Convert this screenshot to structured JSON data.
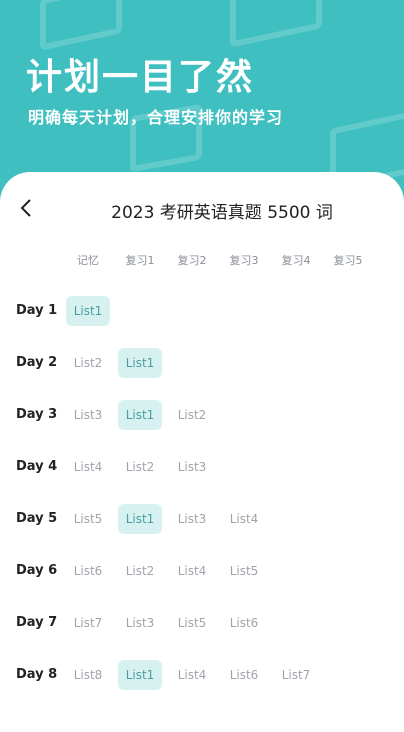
{
  "hero": {
    "title": "计划一目了然",
    "subtitle": "明确每天计划，合理安排你的学习"
  },
  "header": {
    "back_icon": "chevron-left-icon",
    "title": "2023 考研英语真题 5500 词"
  },
  "columns": [
    "记忆",
    "复习1",
    "复习2",
    "复习3",
    "复习4",
    "复习5"
  ],
  "rows": [
    {
      "day": "Day 1",
      "cells": [
        "List1",
        "",
        "",
        "",
        ""
      ],
      "highlight": [
        0
      ]
    },
    {
      "day": "Day 2",
      "cells": [
        "List2",
        "List1",
        "",
        "",
        ""
      ],
      "highlight": [
        1
      ]
    },
    {
      "day": "Day 3",
      "cells": [
        "List3",
        "List1",
        "List2",
        "",
        ""
      ],
      "highlight": [
        1
      ]
    },
    {
      "day": "Day 4",
      "cells": [
        "List4",
        "List2",
        "List3",
        "",
        ""
      ],
      "highlight": []
    },
    {
      "day": "Day 5",
      "cells": [
        "List5",
        "List1",
        "List3",
        "List4",
        ""
      ],
      "highlight": [
        1
      ]
    },
    {
      "day": "Day 6",
      "cells": [
        "List6",
        "List2",
        "List4",
        "List5",
        ""
      ],
      "highlight": []
    },
    {
      "day": "Day 7",
      "cells": [
        "List7",
        "List3",
        "List5",
        "List6",
        ""
      ],
      "highlight": []
    },
    {
      "day": "Day 8",
      "cells": [
        "List8",
        "List1",
        "List4",
        "List6",
        "List7"
      ],
      "highlight": [
        1
      ]
    }
  ],
  "colors": {
    "background": "#3fbfc0",
    "highlight_bg": "#d7f1f1",
    "highlight_text": "#4a9ea0"
  }
}
